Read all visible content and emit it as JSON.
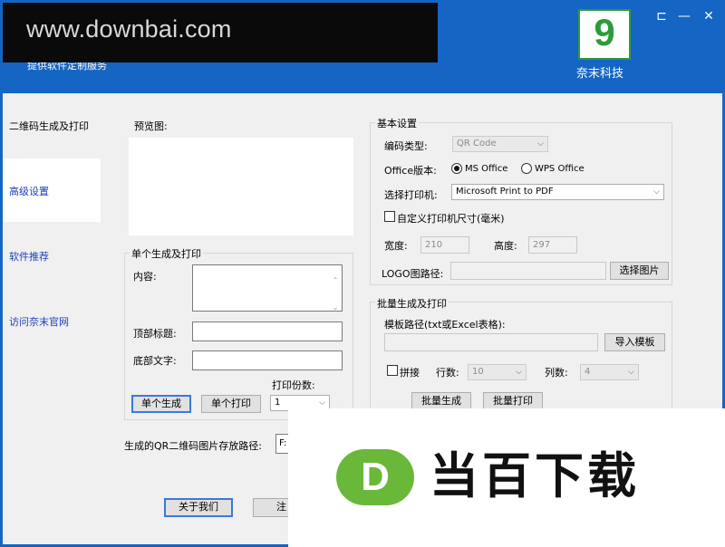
{
  "header": {
    "watermark": "www.downbai.com",
    "subtitle": "提供软件定制服务",
    "logo_caption": "奈末科技",
    "logo_mark": "9",
    "window_buttons": {
      "pin": "⊏",
      "minimize": "—",
      "close": "✕"
    }
  },
  "sidebar": {
    "items": [
      {
        "label": "二维码生成及打印"
      },
      {
        "label": "高级设置"
      },
      {
        "label": "软件推荐"
      },
      {
        "label": "访问奈末官网"
      }
    ]
  },
  "preview": {
    "label": "预览图:"
  },
  "single": {
    "group_title": "单个生成及打印",
    "content_label": "内容:",
    "top_title_label": "顶部标题:",
    "bottom_text_label": "底部文字:",
    "copies_label": "打印份数:",
    "copies_value": "1",
    "generate_button": "单个生成",
    "print_button": "单个打印"
  },
  "save_path": {
    "label": "生成的QR二维码图片存放路径:",
    "value": "F:"
  },
  "basic": {
    "group_title": "基本设置",
    "code_type_label": "编码类型:",
    "code_type_value": "QR Code",
    "office_label": "Office版本:",
    "office_ms": "MS Office",
    "office_wps": "WPS Office",
    "printer_label": "选择打印机:",
    "printer_value": "Microsoft Print to PDF",
    "custom_size_label": "自定义打印机尺寸(毫米)",
    "width_label": "宽度:",
    "width_value": "210",
    "height_label": "高度:",
    "height_value": "297",
    "logo_path_label": "LOGO图路径:",
    "logo_button": "选择图片"
  },
  "batch": {
    "group_title": "批量生成及打印",
    "template_label": "模板路径(txt或Excel表格):",
    "import_button": "导入模板",
    "join_label": "拼接",
    "rows_label": "行数:",
    "rows_value": "10",
    "cols_label": "列数:",
    "cols_value": "4",
    "generate_button": "批量生成",
    "print_button": "批量打印"
  },
  "footer": {
    "about_button": "关于我们",
    "second_button": "注"
  },
  "watermark_bottom": {
    "letter": "D",
    "text": "当百下载"
  },
  "colors": {
    "title_bar": "#1565c4",
    "panel": "#f0f0f0",
    "logo_green": "#2e9b3a",
    "wm_green": "#6ab83a"
  }
}
